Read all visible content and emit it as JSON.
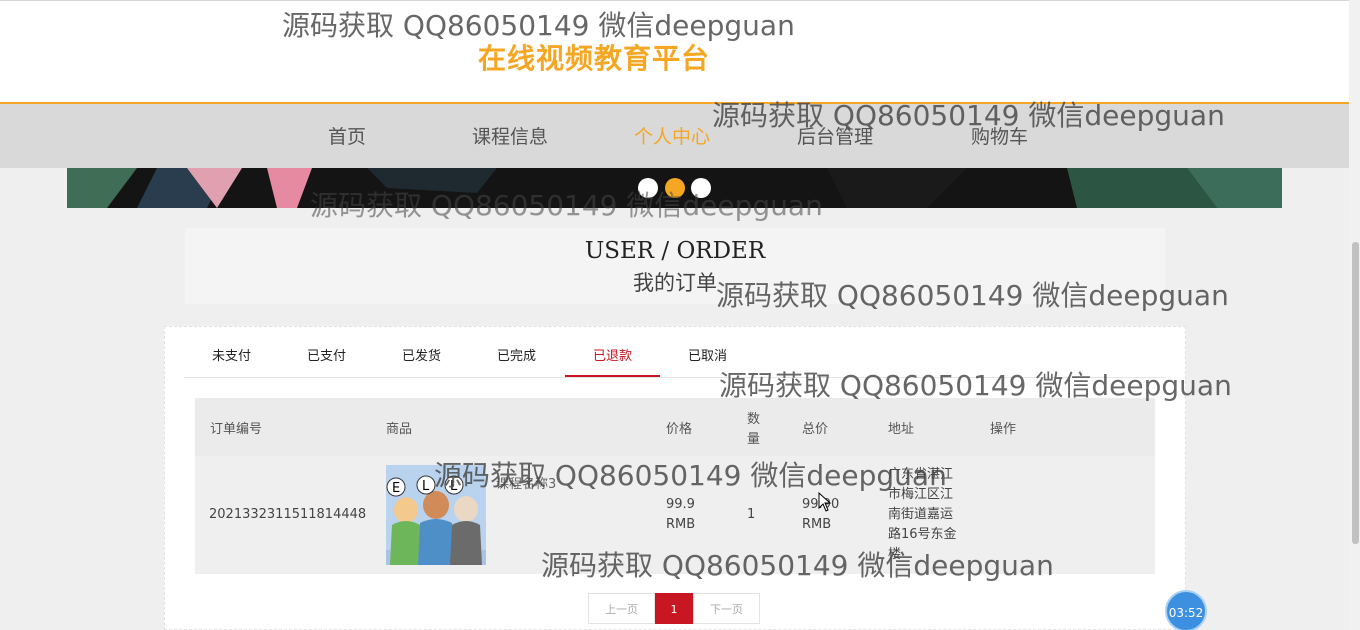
{
  "header": {
    "site_title": "在线视频教育平台"
  },
  "nav": {
    "items": [
      {
        "label": "首页"
      },
      {
        "label": "课程信息"
      },
      {
        "label": "个人中心"
      },
      {
        "label": "后台管理"
      },
      {
        "label": "购物车"
      }
    ],
    "active": "个人中心"
  },
  "banner": {
    "slide_count": 3,
    "active_slide": 2
  },
  "page_title": {
    "en": "USER / ORDER",
    "cn": "我的订单"
  },
  "tabs": [
    {
      "label": "未支付"
    },
    {
      "label": "已支付"
    },
    {
      "label": "已发货"
    },
    {
      "label": "已完成"
    },
    {
      "label": "已退款"
    },
    {
      "label": "已取消"
    }
  ],
  "active_tab": "已退款",
  "table": {
    "headers": {
      "order_no": "订单编号",
      "product": "商品",
      "price": "价格",
      "qty_line1": "数",
      "qty_line2": "量",
      "total": "总价",
      "address": "地址",
      "action": "操作"
    },
    "rows": [
      {
        "order_no": "2021332311511814448",
        "product_name": "课程名称3",
        "price_value": "99.9",
        "price_unit": "RMB",
        "qty": "1",
        "total_value": "99.90",
        "total_unit": "RMB",
        "address_lines": [
          "广东省湛江",
          "市梅江区江",
          "南街道嘉运",
          "路16号东金",
          "楼"
        ],
        "thumbnail_letters": [
          "E",
          "L",
          "L"
        ]
      }
    ]
  },
  "pagination": {
    "prev": "上一页",
    "current": "1",
    "next": "下一页"
  },
  "watermark": {
    "text": "源码获取 QQ86050149 微信deepguan"
  },
  "timer": "03:52",
  "colors": {
    "accent": "#f5a623",
    "active_tab": "#c81623",
    "timer": "#3d8fe0"
  }
}
